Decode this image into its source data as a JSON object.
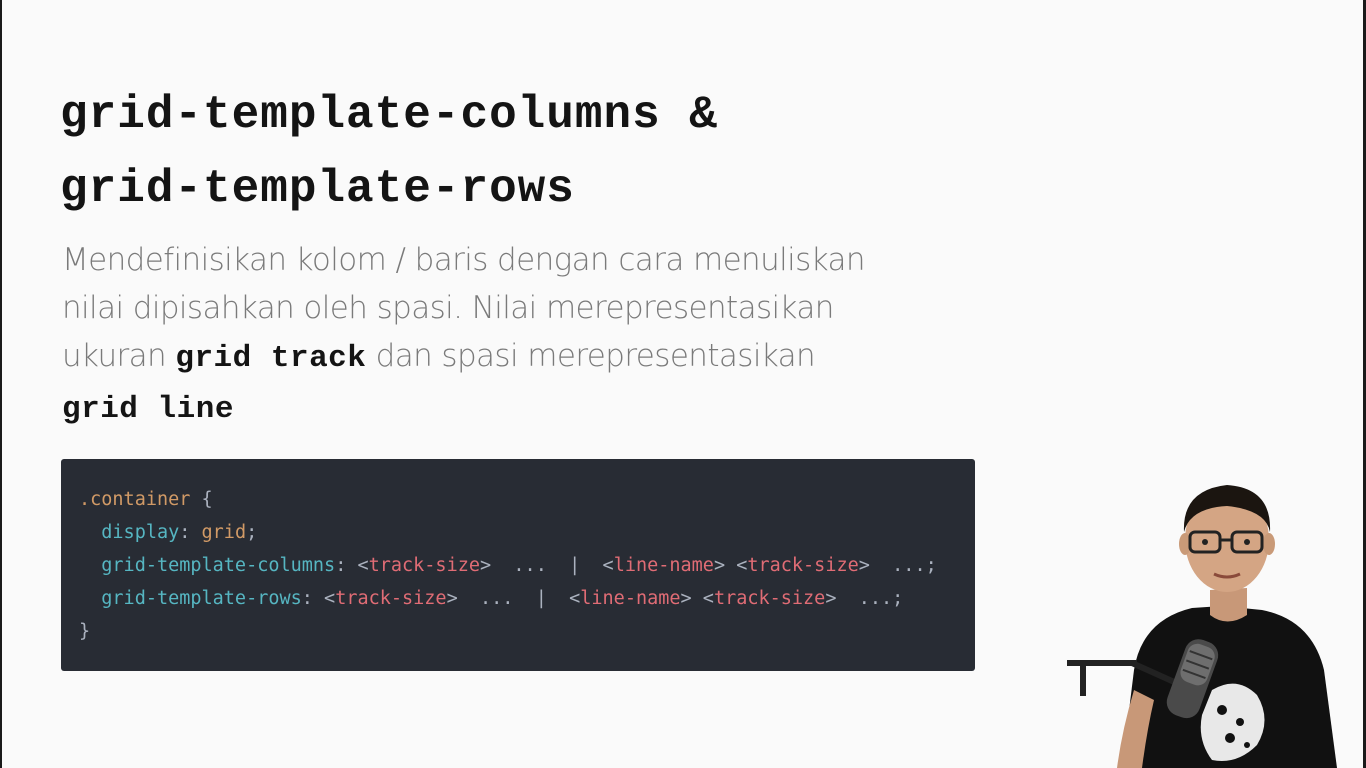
{
  "slide": {
    "title_line1": "grid-template-columns &",
    "title_line2": "grid-template-rows",
    "desc_part1": "Mendefinisikan kolom / baris dengan cara menuliskan nilai dipisahkan oleh spasi. Nilai merepresentasikan ukuran ",
    "desc_kw1": "grid track",
    "desc_part2": " dan spasi merepresentasikan ",
    "desc_kw2": "grid line"
  },
  "code": {
    "selector": ".container",
    "open_brace": "{",
    "close_brace": "}",
    "l2_prop": "display",
    "l2_val": "grid",
    "l3_prop": "grid-template-columns",
    "l4_prop": "grid-template-rows",
    "track_size": "track-size",
    "line_name": "line-name",
    "ellipsis": "...",
    "pipe": "|"
  },
  "colors": {
    "code_bg": "#282c34",
    "selector": "#d19a66",
    "property": "#56b6c2",
    "placeholder": "#e06c75"
  }
}
